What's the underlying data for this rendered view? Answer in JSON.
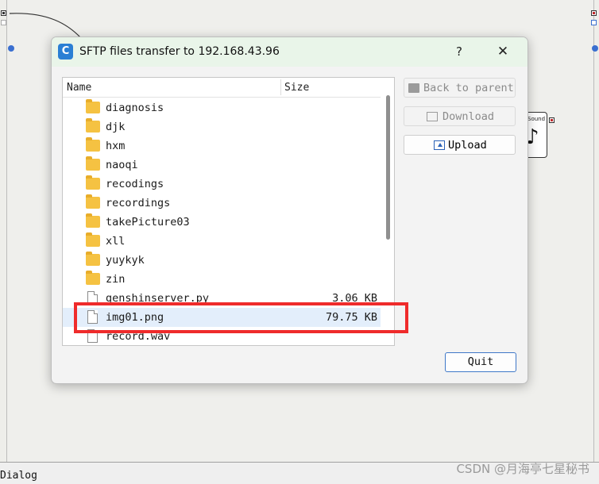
{
  "dialog": {
    "app_icon_letter": "C",
    "title": "SFTP files transfer to 192.168.43.96",
    "help_label": "?",
    "close_label": "✕"
  },
  "file_list": {
    "columns": {
      "name": "Name",
      "size": "Size"
    },
    "rows": [
      {
        "name": "diagnosis",
        "size": "",
        "type": "folder"
      },
      {
        "name": "djk",
        "size": "",
        "type": "folder"
      },
      {
        "name": "hxm",
        "size": "",
        "type": "folder"
      },
      {
        "name": "naoqi",
        "size": "",
        "type": "folder"
      },
      {
        "name": "recodings",
        "size": "",
        "type": "folder"
      },
      {
        "name": "recordings",
        "size": "",
        "type": "folder"
      },
      {
        "name": "takePicture03",
        "size": "",
        "type": "folder"
      },
      {
        "name": "xll",
        "size": "",
        "type": "folder"
      },
      {
        "name": "yuykyk",
        "size": "",
        "type": "folder"
      },
      {
        "name": "zin",
        "size": "",
        "type": "folder"
      },
      {
        "name": "genshinserver.py",
        "size": "3.06 KB",
        "type": "file"
      },
      {
        "name": "img01.png",
        "size": "79.75 KB",
        "type": "file",
        "selected": true
      },
      {
        "name": "record.wav",
        "size": "",
        "type": "file"
      }
    ]
  },
  "actions": {
    "back": "Back to parent",
    "download": "Download",
    "upload": "Upload",
    "quit": "Quit"
  },
  "background": {
    "sound_box_label": "Sound",
    "note_glyph": "♪"
  },
  "status_bar": {
    "text": "Dialog"
  },
  "watermark": "CSDN @月海亭七星秘书",
  "colors": {
    "highlight": "#ef2b2b",
    "title_bg": "#e9f5e9",
    "accent": "#3f78c8"
  }
}
